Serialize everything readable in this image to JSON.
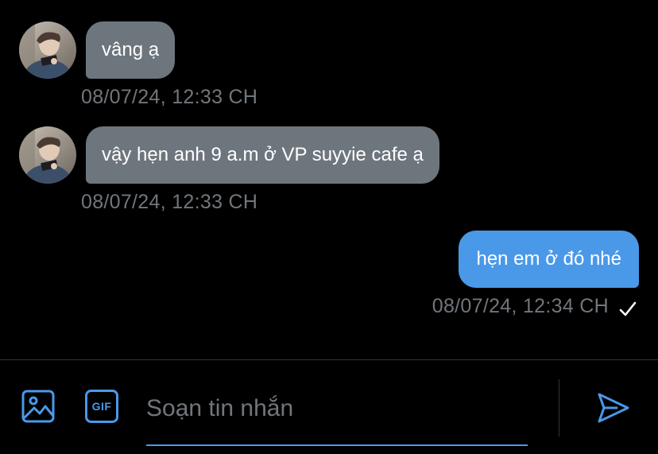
{
  "messages": [
    {
      "direction": "incoming",
      "text": "vâng ạ",
      "timestamp": "08/07/24, 12:33 CH"
    },
    {
      "direction": "incoming",
      "text": "vậy hẹn anh 9 a.m ở VP suyyie cafe ạ",
      "timestamp": "08/07/24, 12:33 CH"
    },
    {
      "direction": "outgoing",
      "text": "hẹn em ở đó nhé",
      "timestamp": "08/07/24, 12:34 CH",
      "status": "sent-check-icon"
    }
  ],
  "composer": {
    "placeholder": "Soạn tin nhắn",
    "value": "",
    "media_icon": "image-icon",
    "gif_icon": "gif-icon",
    "gif_label": "GIF",
    "send_icon": "send-icon"
  },
  "colors": {
    "background": "#000000",
    "incoming_bubble": "#6e767d",
    "outgoing_bubble": "#4a99e9",
    "timestamp": "#71767b",
    "accent": "#4a99e9"
  }
}
